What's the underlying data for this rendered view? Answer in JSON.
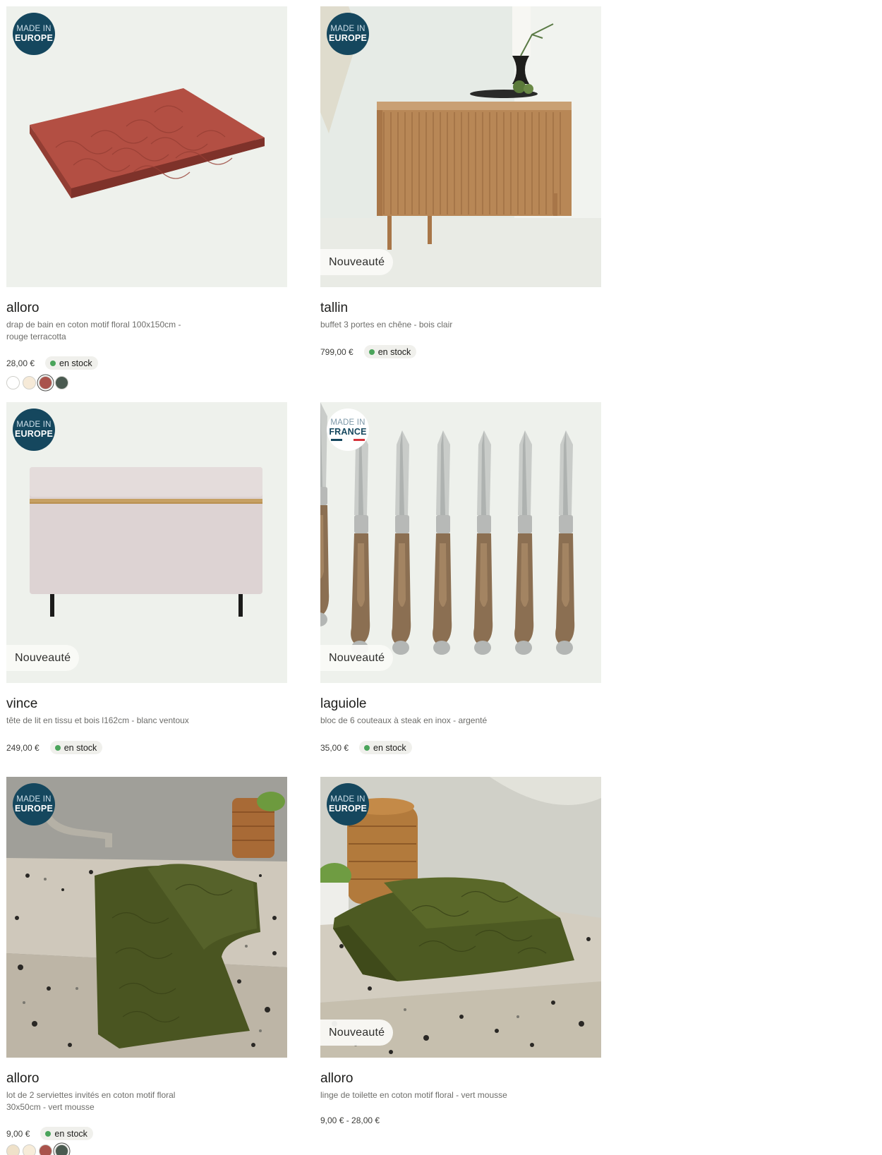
{
  "products": [
    {
      "name": "alloro",
      "description": "drap de bain en coton motif floral 100x150cm - rouge terracotta",
      "price": "28,00 €",
      "stock": "en stock",
      "origin_badge": {
        "line1": "MADE IN",
        "line2": "EUROPE"
      },
      "swatches": [
        "#ffffff",
        "#f6ead8",
        "#a9534c",
        "#4a5a50"
      ],
      "selected_swatch": 2
    },
    {
      "name": "tallin",
      "description": "buffet 3 portes en chêne - bois clair",
      "price": "799,00 €",
      "stock": "en stock",
      "origin_badge": {
        "line1": "MADE IN",
        "line2": "EUROPE"
      },
      "tag": "Nouveauté"
    },
    {
      "name": "vince",
      "description": "tête de lit en tissu et bois l162cm - blanc ventoux",
      "price": "249,00 €",
      "stock": "en stock",
      "origin_badge": {
        "line1": "MADE IN",
        "line2": "EUROPE"
      },
      "tag": "Nouveauté"
    },
    {
      "name": "laguiole",
      "description": "bloc de 6 couteaux à steak en inox - argenté",
      "price": "35,00 €",
      "stock": "en stock",
      "origin_badge": {
        "line1": "MADE IN",
        "line2": "FRANCE"
      },
      "tag": "Nouveauté"
    },
    {
      "name": "alloro",
      "description": "lot de 2 serviettes invités en coton motif floral 30x50cm - vert mousse",
      "price": "9,00 €",
      "stock": "en stock",
      "origin_badge": {
        "line1": "MADE IN",
        "line2": "EUROPE"
      },
      "swatches": [
        "#efe1c9",
        "#f7ecd9",
        "#a9534c",
        "#4a5a50"
      ],
      "selected_swatch": 3
    },
    {
      "name": "alloro",
      "description": "linge de toilette en coton motif floral - vert mousse",
      "price": "9,00 € - 28,00 €",
      "origin_badge": {
        "line1": "MADE IN",
        "line2": "EUROPE"
      },
      "tag": "Nouveauté"
    }
  ],
  "colors": {
    "badge_bg": "#15475e",
    "stock_dot": "#4aa45b",
    "stock_bg": "#f0f0ec",
    "image_bg": "#eef1ec"
  }
}
